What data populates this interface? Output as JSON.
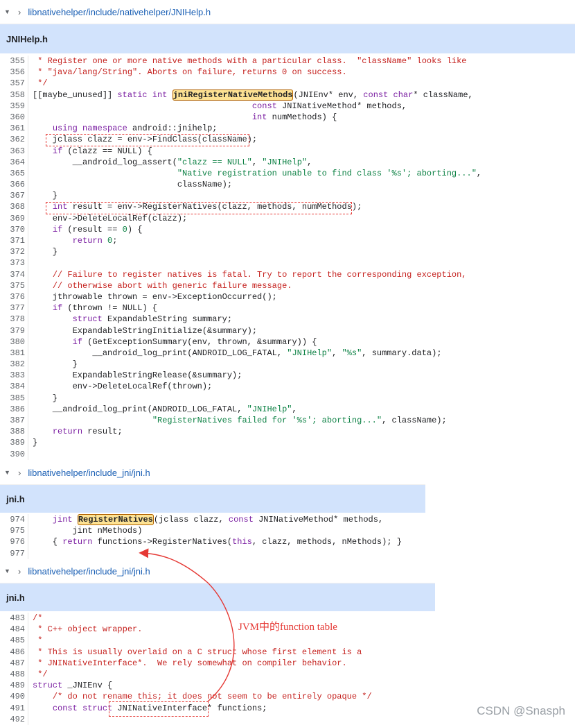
{
  "panel1": {
    "path": "libnativehelper/include/nativehelper/JNIHelp.h",
    "title": "JNIHelp.h",
    "lines": [
      {
        "n": "355",
        "segs": [
          {
            "c": "cm",
            "t": " * Register one or more native methods with a particular class.  \"className\" looks like"
          }
        ]
      },
      {
        "n": "356",
        "segs": [
          {
            "c": "cm",
            "t": " * \"java/lang/String\". Aborts on failure, returns 0 on success."
          }
        ]
      },
      {
        "n": "357",
        "segs": [
          {
            "c": "cm",
            "t": " */"
          }
        ]
      },
      {
        "n": "358",
        "segs": [
          {
            "c": "",
            "t": "[[maybe_unused]] "
          },
          {
            "c": "kw",
            "t": "static int "
          },
          {
            "c": "hl",
            "t": "jniRegisterNativeMethods"
          },
          {
            "c": "",
            "t": "(JNIEnv* env, "
          },
          {
            "c": "kw",
            "t": "const char"
          },
          {
            "c": "",
            "t": "* className,"
          }
        ]
      },
      {
        "n": "359",
        "segs": [
          {
            "c": "",
            "t": "                                            "
          },
          {
            "c": "kw",
            "t": "const"
          },
          {
            "c": "",
            "t": " JNINativeMethod* methods,"
          }
        ]
      },
      {
        "n": "360",
        "segs": [
          {
            "c": "",
            "t": "                                            "
          },
          {
            "c": "kw",
            "t": "int"
          },
          {
            "c": "",
            "t": " numMethods) {"
          }
        ]
      },
      {
        "n": "361",
        "segs": [
          {
            "c": "",
            "t": "    "
          },
          {
            "c": "kw",
            "t": "using namespace"
          },
          {
            "c": "",
            "t": " android::jnihelp;"
          }
        ]
      },
      {
        "n": "362",
        "segs": [
          {
            "c": "",
            "t": "    jclass clazz = env->FindClass(className);"
          }
        ]
      },
      {
        "n": "363",
        "segs": [
          {
            "c": "",
            "t": "    "
          },
          {
            "c": "kw",
            "t": "if"
          },
          {
            "c": "",
            "t": " (clazz == NULL) {"
          }
        ]
      },
      {
        "n": "364",
        "segs": [
          {
            "c": "",
            "t": "        __android_log_assert("
          },
          {
            "c": "str",
            "t": "\"clazz == NULL\""
          },
          {
            "c": "",
            "t": ", "
          },
          {
            "c": "str",
            "t": "\"JNIHelp\""
          },
          {
            "c": "",
            "t": ","
          }
        ]
      },
      {
        "n": "365",
        "segs": [
          {
            "c": "",
            "t": "                             "
          },
          {
            "c": "str",
            "t": "\"Native registration unable to find class '%s'; aborting...\""
          },
          {
            "c": "",
            "t": ","
          }
        ]
      },
      {
        "n": "366",
        "segs": [
          {
            "c": "",
            "t": "                             className);"
          }
        ]
      },
      {
        "n": "367",
        "segs": [
          {
            "c": "",
            "t": "    }"
          }
        ]
      },
      {
        "n": "368",
        "segs": [
          {
            "c": "",
            "t": "    "
          },
          {
            "c": "kw",
            "t": "int"
          },
          {
            "c": "",
            "t": " result = env->RegisterNatives(clazz, methods, numMethods);"
          }
        ]
      },
      {
        "n": "369",
        "segs": [
          {
            "c": "",
            "t": "    env->DeleteLocalRef(clazz);"
          }
        ]
      },
      {
        "n": "370",
        "segs": [
          {
            "c": "",
            "t": "    "
          },
          {
            "c": "kw",
            "t": "if"
          },
          {
            "c": "",
            "t": " (result == "
          },
          {
            "c": "num",
            "t": "0"
          },
          {
            "c": "",
            "t": ") {"
          }
        ]
      },
      {
        "n": "371",
        "segs": [
          {
            "c": "",
            "t": "        "
          },
          {
            "c": "kw",
            "t": "return"
          },
          {
            "c": "",
            "t": " "
          },
          {
            "c": "num",
            "t": "0"
          },
          {
            "c": "",
            "t": ";"
          }
        ]
      },
      {
        "n": "372",
        "segs": [
          {
            "c": "",
            "t": "    }"
          }
        ]
      },
      {
        "n": "373",
        "segs": [
          {
            "c": "",
            "t": ""
          }
        ]
      },
      {
        "n": "374",
        "segs": [
          {
            "c": "",
            "t": "    "
          },
          {
            "c": "cm",
            "t": "// Failure to register natives is fatal. Try to report the corresponding exception,"
          }
        ]
      },
      {
        "n": "375",
        "segs": [
          {
            "c": "",
            "t": "    "
          },
          {
            "c": "cm",
            "t": "// otherwise abort with generic failure message."
          }
        ]
      },
      {
        "n": "376",
        "segs": [
          {
            "c": "",
            "t": "    jthrowable thrown = env->ExceptionOccurred();"
          }
        ]
      },
      {
        "n": "377",
        "segs": [
          {
            "c": "",
            "t": "    "
          },
          {
            "c": "kw",
            "t": "if"
          },
          {
            "c": "",
            "t": " (thrown != NULL) {"
          }
        ]
      },
      {
        "n": "378",
        "segs": [
          {
            "c": "",
            "t": "        "
          },
          {
            "c": "kw",
            "t": "struct"
          },
          {
            "c": "",
            "t": " ExpandableString summary;"
          }
        ]
      },
      {
        "n": "379",
        "segs": [
          {
            "c": "",
            "t": "        ExpandableStringInitialize(&summary);"
          }
        ]
      },
      {
        "n": "380",
        "segs": [
          {
            "c": "",
            "t": "        "
          },
          {
            "c": "kw",
            "t": "if"
          },
          {
            "c": "",
            "t": " (GetExceptionSummary(env, thrown, &summary)) {"
          }
        ]
      },
      {
        "n": "381",
        "segs": [
          {
            "c": "",
            "t": "            __android_log_print(ANDROID_LOG_FATAL, "
          },
          {
            "c": "str",
            "t": "\"JNIHelp\""
          },
          {
            "c": "",
            "t": ", "
          },
          {
            "c": "str",
            "t": "\"%s\""
          },
          {
            "c": "",
            "t": ", summary.data);"
          }
        ]
      },
      {
        "n": "382",
        "segs": [
          {
            "c": "",
            "t": "        }"
          }
        ]
      },
      {
        "n": "383",
        "segs": [
          {
            "c": "",
            "t": "        ExpandableStringRelease(&summary);"
          }
        ]
      },
      {
        "n": "384",
        "segs": [
          {
            "c": "",
            "t": "        env->DeleteLocalRef(thrown);"
          }
        ]
      },
      {
        "n": "385",
        "segs": [
          {
            "c": "",
            "t": "    }"
          }
        ]
      },
      {
        "n": "386",
        "segs": [
          {
            "c": "",
            "t": "    __android_log_print(ANDROID_LOG_FATAL, "
          },
          {
            "c": "str",
            "t": "\"JNIHelp\""
          },
          {
            "c": "",
            "t": ","
          }
        ]
      },
      {
        "n": "387",
        "segs": [
          {
            "c": "",
            "t": "                        "
          },
          {
            "c": "str",
            "t": "\"RegisterNatives failed for '%s'; aborting...\""
          },
          {
            "c": "",
            "t": ", className);"
          }
        ]
      },
      {
        "n": "388",
        "segs": [
          {
            "c": "",
            "t": "    "
          },
          {
            "c": "kw",
            "t": "return"
          },
          {
            "c": "",
            "t": " result;"
          }
        ]
      },
      {
        "n": "389",
        "segs": [
          {
            "c": "",
            "t": "}"
          }
        ]
      },
      {
        "n": "390",
        "segs": [
          {
            "c": "",
            "t": ""
          }
        ]
      }
    ]
  },
  "panel2": {
    "path": "libnativehelper/include_jni/jni.h",
    "title": "jni.h",
    "lines": [
      {
        "n": "974",
        "segs": [
          {
            "c": "",
            "t": "    "
          },
          {
            "c": "kw",
            "t": "jint"
          },
          {
            "c": "",
            "t": " "
          },
          {
            "c": "hl",
            "t": "RegisterNatives"
          },
          {
            "c": "",
            "t": "(jclass clazz, "
          },
          {
            "c": "kw",
            "t": "const"
          },
          {
            "c": "",
            "t": " JNINativeMethod* methods,"
          }
        ]
      },
      {
        "n": "975",
        "segs": [
          {
            "c": "",
            "t": "        jint nMethods)"
          }
        ]
      },
      {
        "n": "976",
        "segs": [
          {
            "c": "",
            "t": "    { "
          },
          {
            "c": "kw",
            "t": "return"
          },
          {
            "c": "",
            "t": " functions->RegisterNatives("
          },
          {
            "c": "kw",
            "t": "this"
          },
          {
            "c": "",
            "t": ", clazz, methods, nMethods); }"
          }
        ]
      },
      {
        "n": "977",
        "segs": [
          {
            "c": "",
            "t": ""
          }
        ]
      }
    ]
  },
  "panel3": {
    "path": "libnativehelper/include_jni/jni.h",
    "title": "jni.h",
    "lines": [
      {
        "n": "483",
        "segs": [
          {
            "c": "cm",
            "t": "/*"
          }
        ]
      },
      {
        "n": "484",
        "segs": [
          {
            "c": "cm",
            "t": " * C++ object wrapper."
          }
        ]
      },
      {
        "n": "485",
        "segs": [
          {
            "c": "cm",
            "t": " *"
          }
        ]
      },
      {
        "n": "486",
        "segs": [
          {
            "c": "cm",
            "t": " * This is usually overlaid on a C struct whose first element is a"
          }
        ]
      },
      {
        "n": "487",
        "segs": [
          {
            "c": "cm",
            "t": " * JNINativeInterface*.  We rely somewhat on compiler behavior."
          }
        ]
      },
      {
        "n": "488",
        "segs": [
          {
            "c": "cm",
            "t": " */"
          }
        ]
      },
      {
        "n": "489",
        "segs": [
          {
            "c": "kw",
            "t": "struct"
          },
          {
            "c": "",
            "t": " _JNIEnv {"
          }
        ]
      },
      {
        "n": "490",
        "segs": [
          {
            "c": "",
            "t": "    "
          },
          {
            "c": "cm",
            "t": "/* do not rename this; it does not seem to be entirely opaque */"
          }
        ]
      },
      {
        "n": "491",
        "segs": [
          {
            "c": "",
            "t": "    "
          },
          {
            "c": "kw",
            "t": "const struct"
          },
          {
            "c": "",
            "t": " JNINativeInterface* functions;"
          }
        ]
      },
      {
        "n": "492",
        "segs": [
          {
            "c": "",
            "t": ""
          }
        ]
      }
    ]
  },
  "annotation": "JVM中的function table",
  "watermark": "CSDN @Snasph",
  "colors": {
    "accent": "#e53935",
    "titlebar": "#d2e3fc",
    "path": "#1a5fb4"
  }
}
